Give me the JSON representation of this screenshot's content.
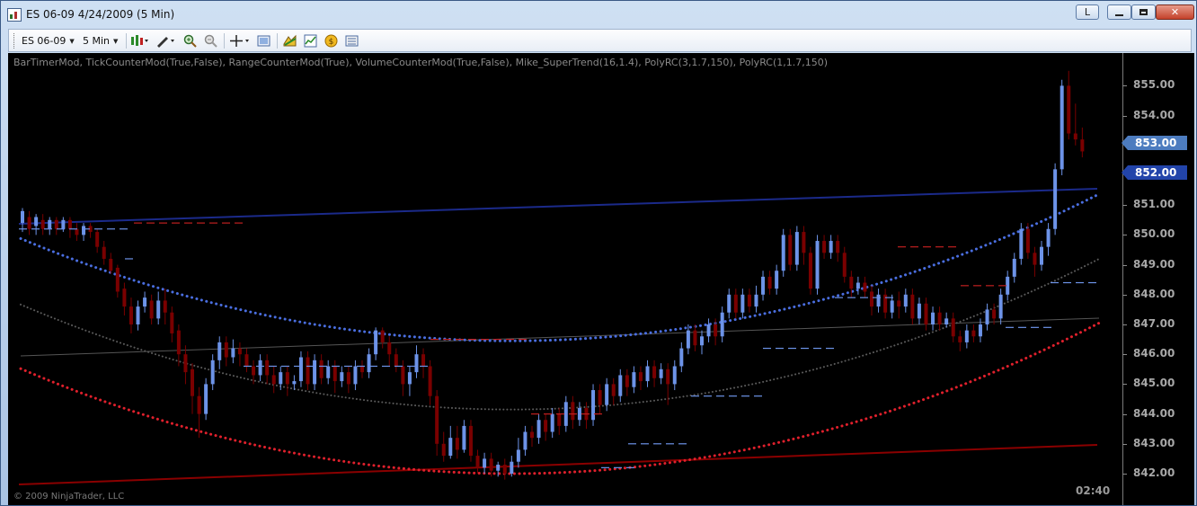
{
  "window": {
    "title": "ES 06-09  4/24/2009 (5 Min)",
    "l_button": "L"
  },
  "toolbar": {
    "instrument": "ES 06-09",
    "interval": "5 Min",
    "icons": [
      "bar-type-icon",
      "draw-tool-icon",
      "zoom-in-icon",
      "zoom-out-icon",
      "crosshair-icon",
      "properties-icon",
      "strategy-icon",
      "chart-icon",
      "orders-icon",
      "data-box-icon"
    ]
  },
  "chart": {
    "indicators": "BarTimerMod,  TickCounterMod(True,False),  RangeCounterMod(True),  VolumeCounterMod(True,False),  Mike_SuperTrend(16,1.4),  PolyRC(3,1.7,150),  PolyRC(1,1.7,150)",
    "copyright": "© 2009 NinjaTrader, LLC",
    "time": "02:40",
    "price_ticks": [
      "855.00",
      "854.00",
      "853.00",
      "852.00",
      "851.00",
      "850.00",
      "849.00",
      "848.00",
      "847.00",
      "846.00",
      "845.00",
      "844.00",
      "843.00",
      "842.00"
    ],
    "tag_last": "853.00",
    "tag_level": "852.00",
    "colors": {
      "up": "#6d93e8",
      "down": "#7a0000",
      "upper_band": "#4a6ee0",
      "lower_band": "#e0202c",
      "mid": "#555555",
      "linreg_up": "#1b2a8a",
      "linreg_dn": "#8a0000"
    }
  }
}
